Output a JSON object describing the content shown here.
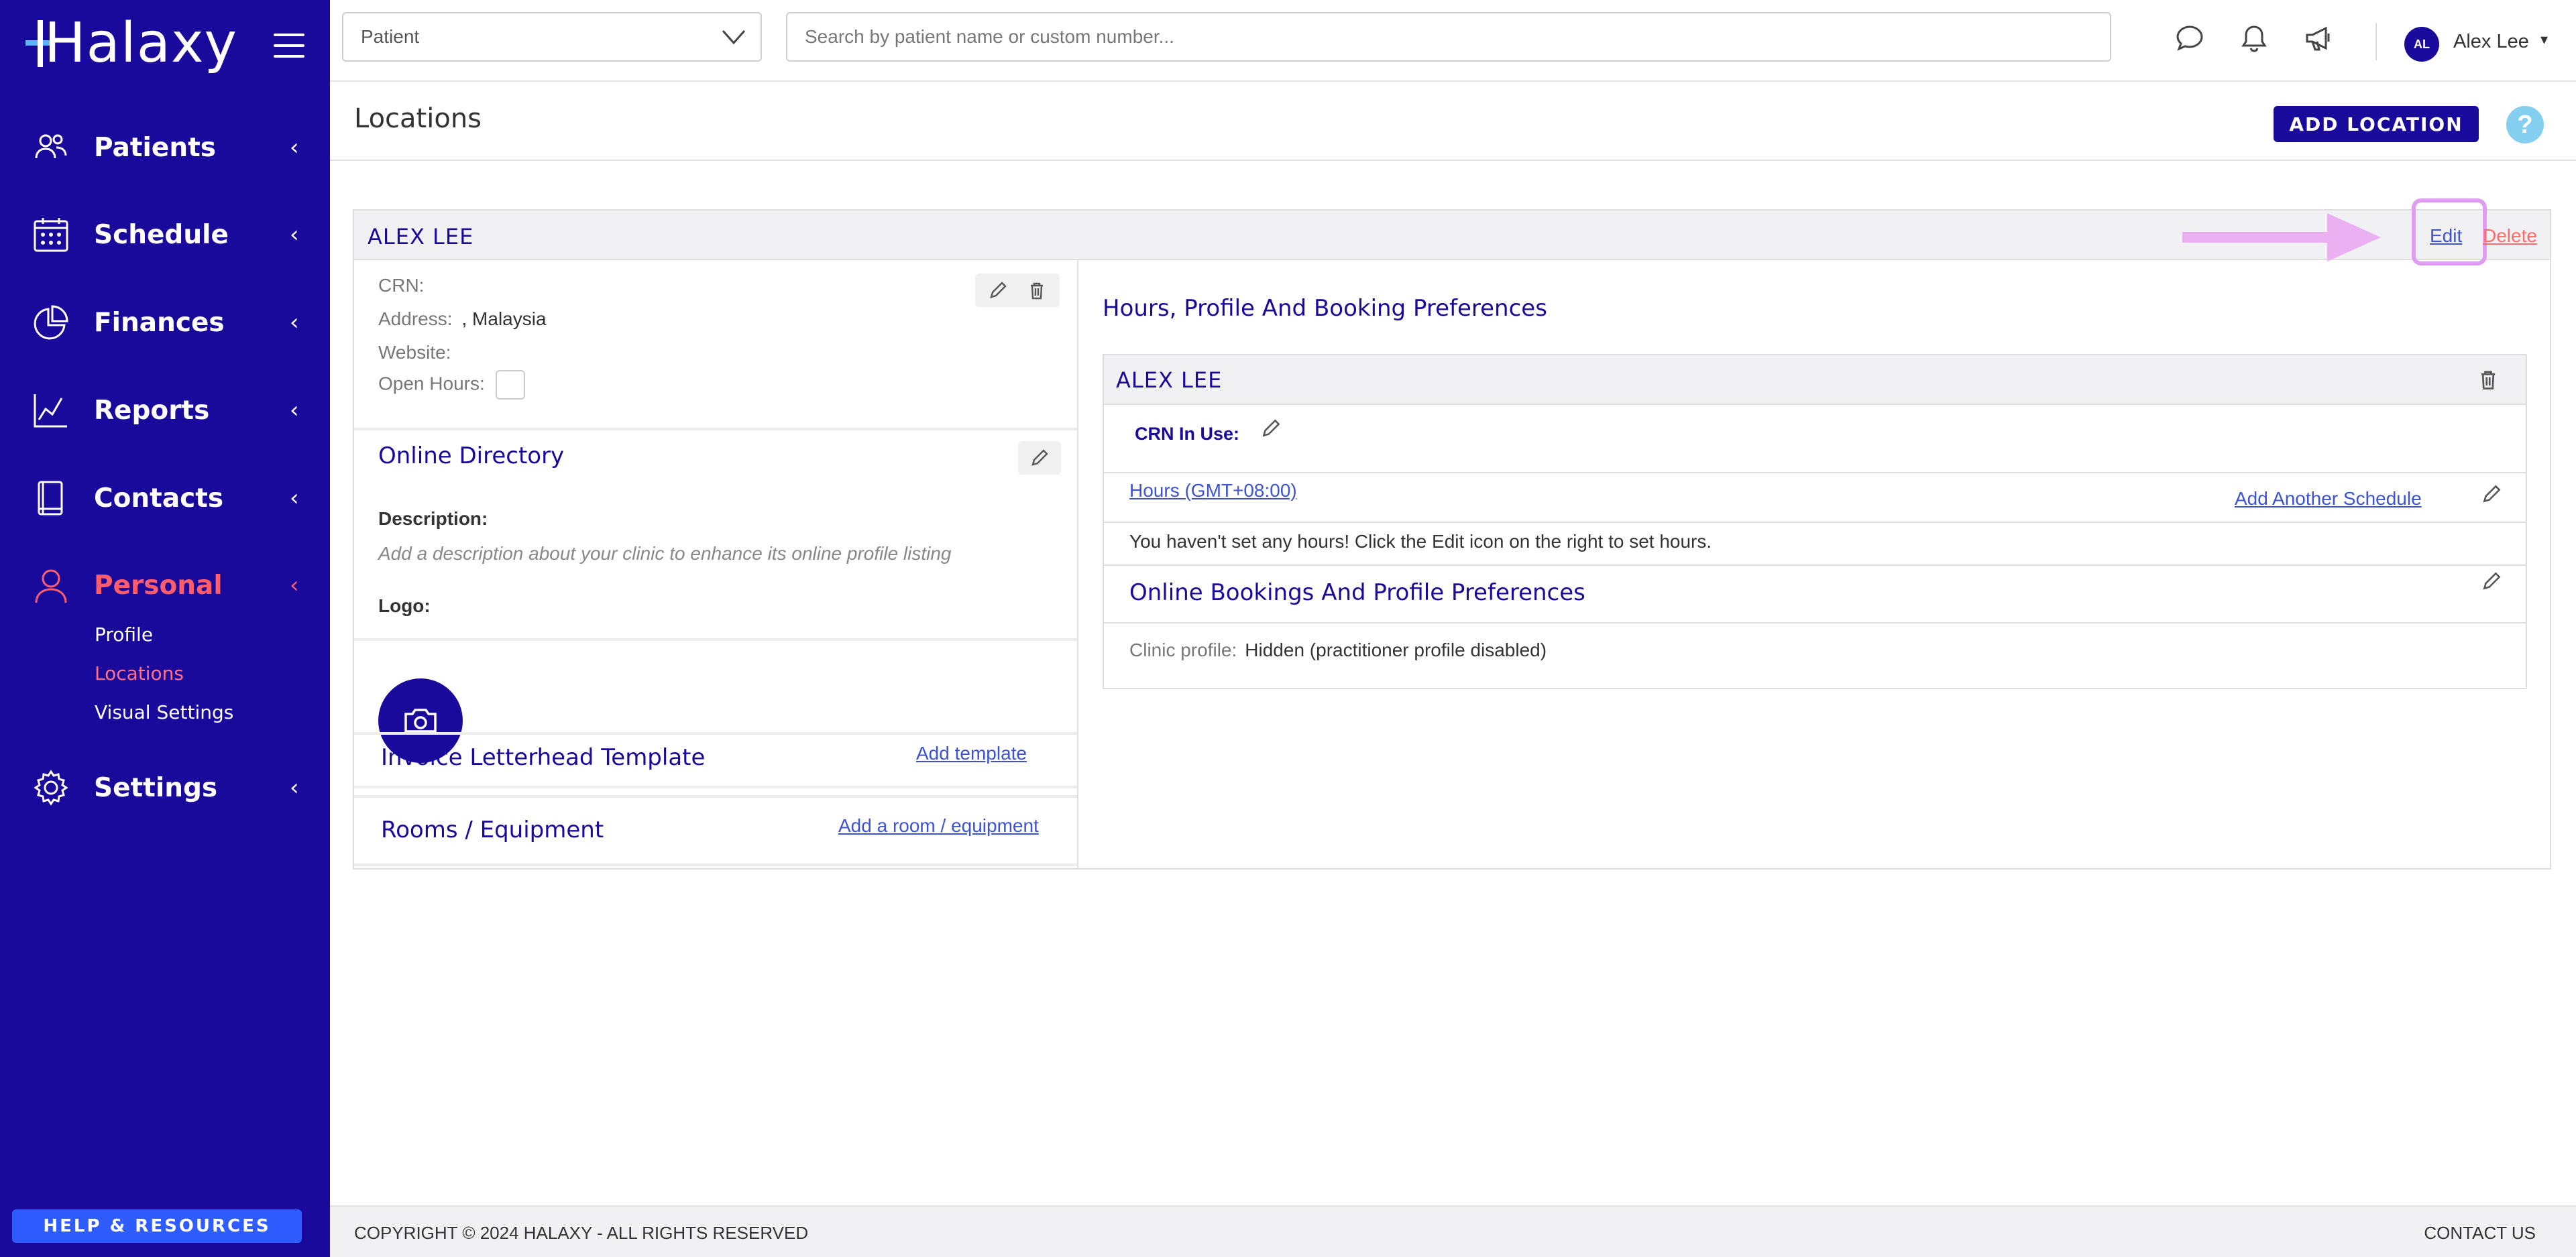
{
  "app": {
    "logo": "Halaxy"
  },
  "sidebar": {
    "items": [
      {
        "label": "Patients",
        "icon": "patients-icon"
      },
      {
        "label": "Schedule",
        "icon": "calendar-icon"
      },
      {
        "label": "Finances",
        "icon": "pie-chart-icon"
      },
      {
        "label": "Reports",
        "icon": "line-chart-icon"
      },
      {
        "label": "Contacts",
        "icon": "book-icon"
      },
      {
        "label": "Personal",
        "icon": "person-icon",
        "active": true
      },
      {
        "label": "Settings",
        "icon": "gear-icon"
      }
    ],
    "sub_items": [
      {
        "label": "Profile"
      },
      {
        "label": "Locations",
        "active": true
      },
      {
        "label": "Visual Settings"
      }
    ],
    "chevron": "‹",
    "help_label": "HELP & RESOURCES"
  },
  "topbar": {
    "select_value": "Patient",
    "search_placeholder": "Search by patient name or custom number...",
    "user_initials": "AL",
    "user_name": "Alex Lee",
    "caret": "▾"
  },
  "page": {
    "title": "Locations",
    "add_button": "ADD LOCATION",
    "help_symbol": "?"
  },
  "location": {
    "name": "ALEX LEE",
    "edit_label": "Edit",
    "delete_label": "Delete",
    "crn_label": "CRN:",
    "crn_value": "",
    "address_label": "Address:",
    "address_value": ", Malaysia",
    "website_label": "Website:",
    "website_value": "",
    "open_hours_label": "Open Hours:",
    "online_directory_title": "Online Directory",
    "description_label": "Description:",
    "description_placeholder": "Add a description about your clinic to enhance its online profile listing",
    "logo_label": "Logo:",
    "invoice_title": "Invoice Letterhead Template",
    "add_template": "Add template",
    "rooms_title": "Rooms / Equipment",
    "add_room": "Add a room / equipment"
  },
  "preferences": {
    "title": "Hours, Profile And Booking Preferences",
    "practitioner_name": "ALEX LEE",
    "crn_in_use_label": "CRN In Use:",
    "hours_link": "Hours (GMT+08:00)",
    "add_schedule": "Add Another Schedule",
    "no_hours_msg": "You haven't set any hours! Click the Edit icon on the right to set hours.",
    "online_bookings_title": "Online Bookings And Profile Preferences",
    "clinic_profile_label": "Clinic profile:",
    "clinic_profile_value": "Hidden (practitioner profile disabled)"
  },
  "footer": {
    "copyright": "COPYRIGHT © 2024 HALAXY - ALL RIGHTS RESERVED",
    "contact": "CONTACT US"
  },
  "colors": {
    "brand": "#1a0a9c",
    "accent": "#ff5d6c",
    "link": "#3d52d5",
    "highlight": "#e09cf0"
  }
}
